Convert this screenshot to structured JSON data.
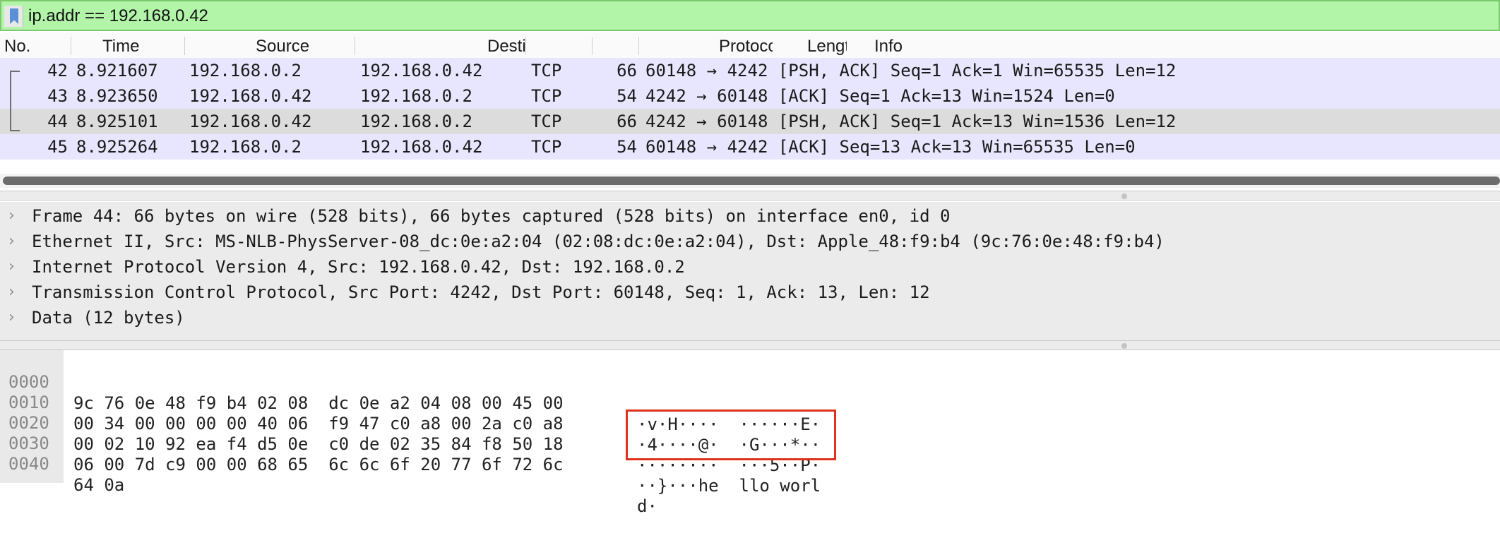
{
  "filter": {
    "value": "ip.addr == 192.168.0.42",
    "bookmark_icon": "bookmark-icon"
  },
  "packet_list": {
    "columns": [
      "No.",
      "Time",
      "Source",
      "Destination",
      "Protocol",
      "Length",
      "Info"
    ],
    "rows": [
      {
        "no": "42",
        "time": "8.921607",
        "source": "192.168.0.2",
        "destination": "192.168.0.42",
        "protocol": "TCP",
        "length": "66",
        "info": "60148 → 4242 [PSH, ACK] Seq=1 Ack=1 Win=65535 Len=12",
        "bg": "#e8e6fe"
      },
      {
        "no": "43",
        "time": "8.923650",
        "source": "192.168.0.42",
        "destination": "192.168.0.2",
        "protocol": "TCP",
        "length": "54",
        "info": "4242 → 60148 [ACK] Seq=1 Ack=13 Win=1524 Len=0",
        "bg": "#e8e6fe"
      },
      {
        "no": "44",
        "time": "8.925101",
        "source": "192.168.0.42",
        "destination": "192.168.0.2",
        "protocol": "TCP",
        "length": "66",
        "info": "4242 → 60148 [PSH, ACK] Seq=1 Ack=13 Win=1536 Len=12",
        "bg": "#dcdcdc"
      },
      {
        "no": "45",
        "time": "8.925264",
        "source": "192.168.0.2",
        "destination": "192.168.0.42",
        "protocol": "TCP",
        "length": "54",
        "info": "60148 → 4242 [ACK] Seq=13 Ack=13 Win=65535 Len=0",
        "bg": "#e8e6fe"
      }
    ]
  },
  "details": {
    "rows": [
      "Frame 44: 66 bytes on wire (528 bits), 66 bytes captured (528 bits) on interface en0, id 0",
      "Ethernet II, Src: MS-NLB-PhysServer-08_dc:0e:a2:04 (02:08:dc:0e:a2:04), Dst: Apple_48:f9:b4 (9c:76:0e:48:f9:b4)",
      "Internet Protocol Version 4, Src: 192.168.0.42, Dst: 192.168.0.2",
      "Transmission Control Protocol, Src Port: 4242, Dst Port: 60148, Seq: 1, Ack: 13, Len: 12",
      "Data (12 bytes)"
    ],
    "expander_glyph": "›"
  },
  "bytes": {
    "rows": [
      {
        "offset": "0000",
        "hex": "9c 76 0e 48 f9 b4 02 08  dc 0e a2 04 08 00 45 00",
        "ascii": "·v·H····  ······E·"
      },
      {
        "offset": "0010",
        "hex": "00 34 00 00 00 00 40 06  f9 47 c0 a8 00 2a c0 a8",
        "ascii": "·4····@·  ·G···*··"
      },
      {
        "offset": "0020",
        "hex": "00 02 10 92 ea f4 d5 0e  c0 de 02 35 84 f8 50 18",
        "ascii": "········  ···5··P·"
      },
      {
        "offset": "0030",
        "hex": "06 00 7d c9 00 00 68 65  6c 6c 6f 20 77 6f 72 6c",
        "ascii": "··}···he  llo worl"
      },
      {
        "offset": "0040",
        "hex": "64 0a",
        "ascii": "d·"
      }
    ]
  },
  "colors": {
    "filter_valid": "#b2f5a9",
    "row_tcp": "#e8e6fe",
    "row_selected": "#dcdcdc",
    "highlight": "#e0301e"
  }
}
